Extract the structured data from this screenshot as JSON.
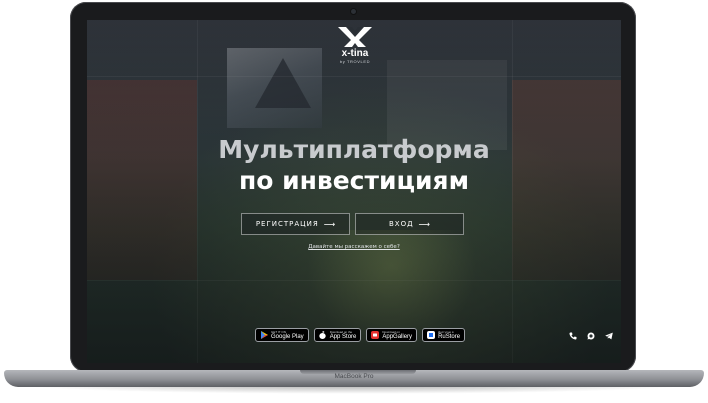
{
  "device": {
    "model_label": "MacBook Pro"
  },
  "brand": {
    "name": "x-tina",
    "tagline": "by TROVLED"
  },
  "hero": {
    "line1": "Мультиплатформа",
    "line2": "по инвестициям"
  },
  "buttons": {
    "register_label": "РЕГИСТРАЦИЯ",
    "login_label": "ВХОД"
  },
  "about_link": "Давайте мы расскажем о себе?",
  "stores": [
    {
      "small": "GET IT ON",
      "name": "Google Play",
      "icon": "google-play-icon"
    },
    {
      "small": "Download on the",
      "name": "App Store",
      "icon": "apple-icon"
    },
    {
      "small": "Download on",
      "name": "AppGallery",
      "icon": "huawei-icon"
    },
    {
      "small": "Доступно в",
      "name": "RuStore",
      "icon": "rustore-icon"
    }
  ],
  "socials": [
    {
      "icon": "phone-icon"
    },
    {
      "icon": "whatsapp-icon"
    },
    {
      "icon": "telegram-icon"
    }
  ],
  "colors": {
    "headline_muted": "#c8cbce",
    "headline_primary": "#ffffff",
    "laptop_frame": "#1a1b1d",
    "store_badge_bg": "#000000"
  }
}
